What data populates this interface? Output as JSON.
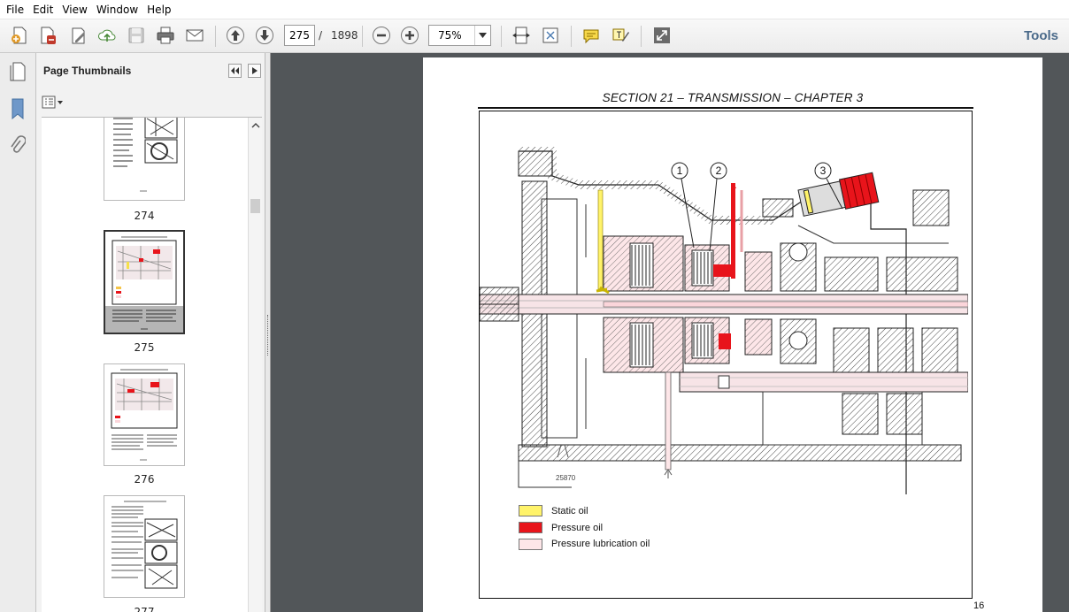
{
  "menu": [
    "File",
    "Edit",
    "View",
    "Window",
    "Help"
  ],
  "toolbar": {
    "icons": [
      "create-icon",
      "convert-icon",
      "edit-icon",
      "upload-icon",
      "save-icon",
      "print-icon",
      "email-icon",
      "previous-page-icon",
      "next-page-icon",
      "zoom-out-icon",
      "zoom-in-icon",
      "fit-width-icon",
      "fit-page-icon",
      "comment-icon",
      "highlight-icon",
      "fullscreen-icon"
    ],
    "page_current": "275",
    "page_separator": "/",
    "page_total": "1898",
    "zoom": "75%",
    "tools_label": "Tools"
  },
  "sidebar": {
    "title": "Page Thumbnails",
    "thumbnails": [
      {
        "label": "274",
        "selected": false
      },
      {
        "label": "275",
        "selected": true
      },
      {
        "label": "276",
        "selected": false
      },
      {
        "label": "277",
        "selected": false
      }
    ]
  },
  "document": {
    "section_header": "SECTION 21 – TRANSMISSION – CHAPTER 3",
    "callouts": [
      "1",
      "2",
      "3"
    ],
    "figure_number": "25870",
    "legend": [
      {
        "label": "Static  oil",
        "color": "#fff36a"
      },
      {
        "label": "Pressure oil",
        "color": "#e8141b"
      },
      {
        "label": "Pressure lubrication oil",
        "color": "#fde6e8"
      }
    ],
    "page_number": "16"
  },
  "colors": {
    "workspace": "#525659",
    "panel": "#f2f2f2",
    "tools": "#4a6a8a"
  }
}
